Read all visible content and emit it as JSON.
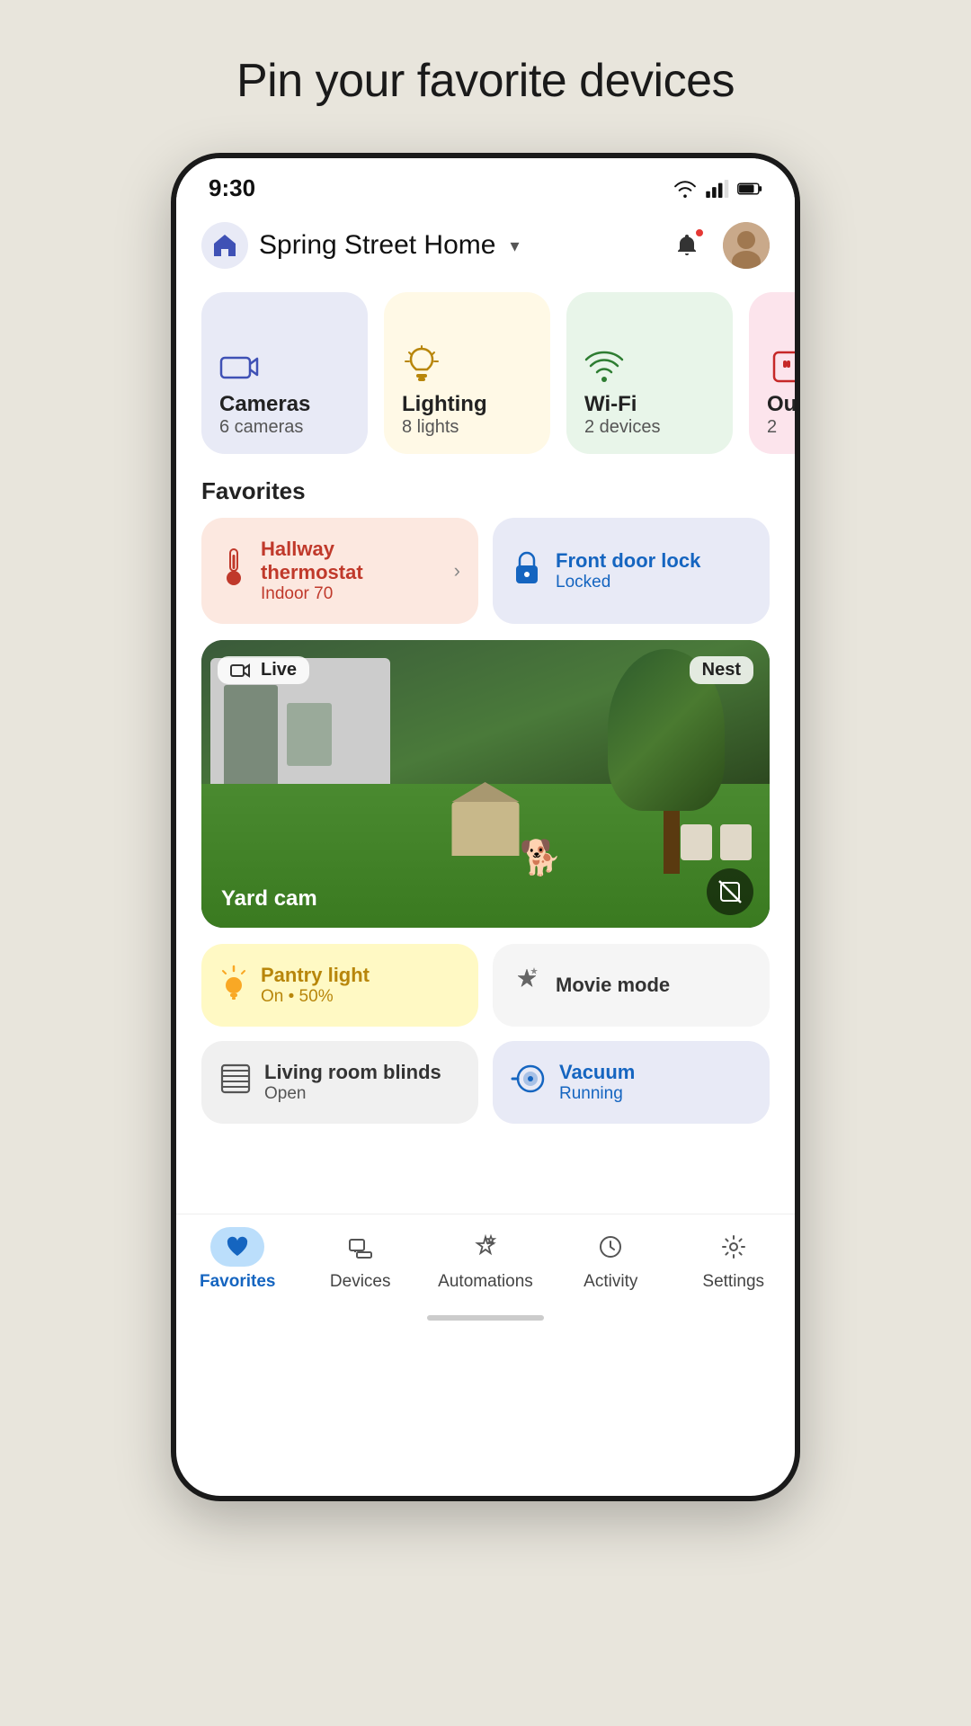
{
  "page": {
    "title": "Pin your favorite devices"
  },
  "statusBar": {
    "time": "9:30",
    "wifi": true,
    "signal": true,
    "battery": true
  },
  "topBar": {
    "homeName": "Spring Street Home",
    "chevron": "▾",
    "bellLabel": "notifications",
    "avatarInitial": "👩"
  },
  "categories": [
    {
      "id": "cameras",
      "icon": "📹",
      "name": "Cameras",
      "sub": "6 cameras",
      "color": "cameras"
    },
    {
      "id": "lighting",
      "icon": "💡",
      "name": "Lighting",
      "sub": "8 lights",
      "color": "lighting"
    },
    {
      "id": "wifi",
      "icon": "📶",
      "name": "Wi-Fi",
      "sub": "2 devices",
      "color": "wifi"
    },
    {
      "id": "extra",
      "icon": "🔌",
      "name": "Outlets",
      "sub": "2",
      "color": "extra"
    }
  ],
  "favorites": {
    "sectionTitle": "Favorites",
    "cards": [
      {
        "id": "thermostat",
        "type": "thermostat",
        "name": "Hallway thermostat",
        "status": "Indoor 70",
        "icon": "🌡️",
        "hasChevron": true
      },
      {
        "id": "frontdoor",
        "type": "lock",
        "name": "Front door lock",
        "status": "Locked",
        "icon": "🔒",
        "hasChevron": false
      }
    ]
  },
  "camera": {
    "label": "Yard cam",
    "liveBadge": "Live",
    "nestBadge": "Nest",
    "muteIcon": "🚫"
  },
  "favRow2": [
    {
      "id": "pantry",
      "type": "pantry",
      "name": "Pantry light",
      "status": "On • 50%",
      "icon": "💡"
    },
    {
      "id": "movie",
      "type": "movie",
      "name": "Movie mode",
      "status": "",
      "icon": "✨"
    }
  ],
  "favRow3": [
    {
      "id": "blinds",
      "type": "blinds",
      "name": "Living room blinds",
      "status": "Open",
      "icon": "▦"
    },
    {
      "id": "vacuum",
      "type": "vacuum",
      "name": "Vacuum",
      "status": "Running",
      "icon": "🤖"
    }
  ],
  "bottomNav": [
    {
      "id": "favorites",
      "label": "Favorites",
      "icon": "heart",
      "active": true
    },
    {
      "id": "devices",
      "label": "Devices",
      "icon": "devices",
      "active": false
    },
    {
      "id": "automations",
      "label": "Automations",
      "icon": "automations",
      "active": false
    },
    {
      "id": "activity",
      "label": "Activity",
      "icon": "activity",
      "active": false
    },
    {
      "id": "settings",
      "label": "Settings",
      "icon": "settings",
      "active": false
    }
  ]
}
